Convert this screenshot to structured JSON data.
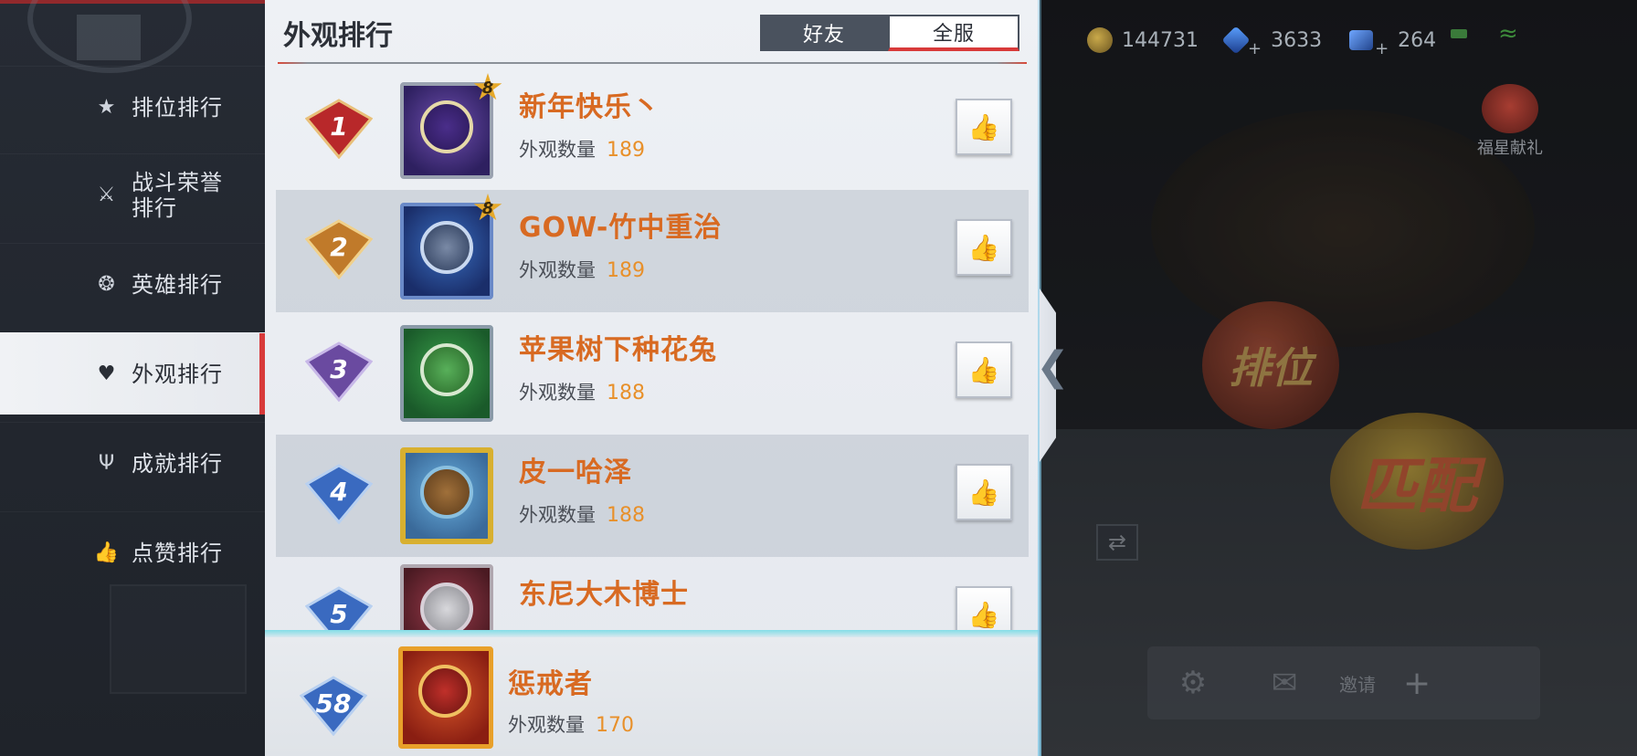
{
  "status": {
    "coins": "144731",
    "gems": "3633",
    "tickets": "264"
  },
  "lobby": {
    "gift_label": "福星献礼",
    "rank_mode": "排位",
    "match_mode": "匹配",
    "invite_label": "邀请"
  },
  "nav": {
    "items": [
      {
        "label": "排位排行",
        "icon": "star-rank-icon"
      },
      {
        "label": "战斗荣誉排行",
        "icon": "crossed-swords-icon"
      },
      {
        "label": "英雄排行",
        "icon": "hero-emblem-icon"
      },
      {
        "label": "外观排行",
        "icon": "shirt-icon",
        "active": true
      },
      {
        "label": "成就排行",
        "icon": "trophy-icon"
      },
      {
        "label": "点赞排行",
        "icon": "thumbs-up-icon"
      }
    ]
  },
  "panel": {
    "title": "外观排行",
    "tabs": {
      "friends": "好友",
      "all": "全服"
    },
    "count_label": "外观数量"
  },
  "rankings": [
    {
      "rank": "1",
      "name": "新年快乐丶",
      "count": "189",
      "level": "8",
      "badge_color": "#c0302a"
    },
    {
      "rank": "2",
      "name": "GOW-竹中重治",
      "count": "189",
      "level": "8",
      "badge_color": "#c07a2a"
    },
    {
      "rank": "3",
      "name": "苹果树下种花兔",
      "count": "188",
      "badge_color": "#6a4aa0"
    },
    {
      "rank": "4",
      "name": "皮一哈泽",
      "count": "188",
      "badge_color": "#3a6ac0"
    },
    {
      "rank": "5",
      "name": "东尼大木博士",
      "badge_color": "#3a6ac0"
    }
  ],
  "self": {
    "rank": "58",
    "name": "惩戒者",
    "count": "170",
    "badge_color": "#3a6ac0"
  },
  "colors": {
    "name": "#d86a22",
    "count": "#e8902a",
    "active_marker": "#d83a3a"
  }
}
